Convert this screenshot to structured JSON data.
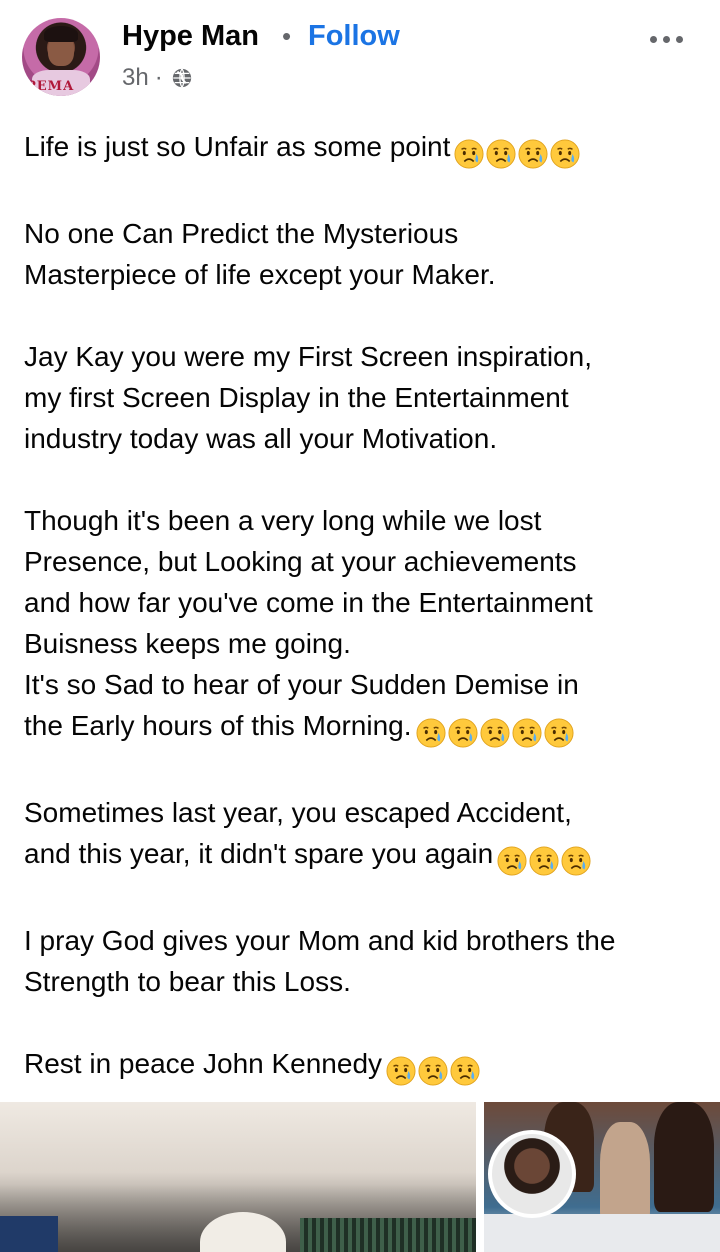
{
  "post": {
    "author": "Hype Man",
    "separator": "•",
    "follow_label": "Follow",
    "time": "3h",
    "meta_dot": "·",
    "privacy_icon": "globe-icon",
    "more_icon": "more-options-icon",
    "avatar_text": "PEMA"
  },
  "body": {
    "p1": "Life is just so Unfair as some point",
    "p2_l1": "No one Can Predict the Mysterious",
    "p2_l2": "Masterpiece of life except your Maker.",
    "p3_l1": "Jay Kay you were my First Screen inspiration,",
    "p3_l2": "my first Screen Display in the Entertainment",
    "p3_l3": "industry today was all your Motivation.",
    "p4_l1": "Though it's been a very long while we lost",
    "p4_l2": "Presence, but Looking at your achievements",
    "p4_l3": "and how far you've come in the Entertainment",
    "p4_l4": "Buisness keeps me going.",
    "p4_l5": "It's so Sad to hear of your Sudden Demise in",
    "p4_l6": "the Early hours of this Morning.",
    "p5_l1": "Sometimes last year, you escaped Accident,",
    "p5_l2": "and this year, it didn't spare you again",
    "p6_l1": "I pray God gives your Mom and kid brothers the",
    "p6_l2": "Strength to bear this Loss.",
    "p7": "Rest in peace John Kennedy"
  },
  "emoji": {
    "name": "sad-but-relieved-face-icon",
    "face_color": "#ffc93c",
    "tear_color": "#5aaef0"
  },
  "colors": {
    "follow": "#1b74e4",
    "secondary": "#65676b",
    "text": "#050505"
  }
}
